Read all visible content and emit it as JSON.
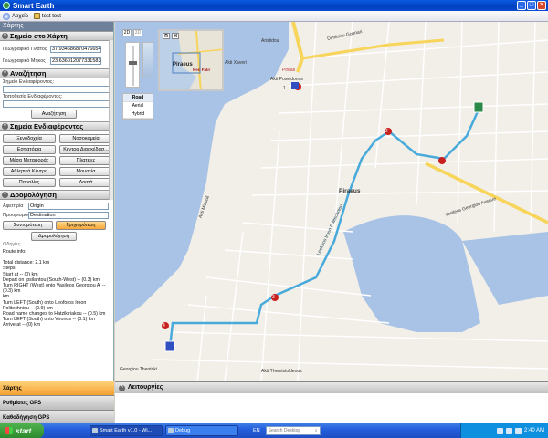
{
  "window": {
    "title": "Smart Earth"
  },
  "menubar": {
    "items": [
      {
        "label": "Αρχείο"
      },
      {
        "label": "test test"
      }
    ]
  },
  "left_panel": {
    "header": "Χάρτης",
    "map_point": {
      "title": "Σημείο στο Χάρτη",
      "lat_label": "Γεωγραφικό Πλάτος",
      "lat_value": "37.934686870476654",
      "lon_label": "Γεωγραφικό Μήκος",
      "lon_value": "23.636012077331583"
    },
    "search": {
      "title": "Αναζήτηση",
      "poi_label": "Σημείο Ενδιαφέροντος:",
      "location_label": "Τοποθεσία Ενδιαφέροντος:",
      "button": "Αναζήτηση"
    },
    "poi": {
      "title": "Σημεία Ενδιαφέροντος",
      "buttons": [
        "Ξενοδοχεία",
        "Νοσοκομεία",
        "Εστιατόρια",
        "Κέντρα Διασκέδασ...",
        "Μέσα Μεταφοράς",
        "Πλατείες",
        "Αθλητικά Κέντρα",
        "Μουσεία",
        "Παραλίες",
        "Λοιπά"
      ]
    },
    "routing": {
      "title": "Δρομολόγηση",
      "start_label": "Αφετηρία",
      "start_value": "Origin",
      "dest_label": "Προορισμός",
      "dest_value": "Destination",
      "shortest": "Συντομότερη",
      "fastest": "Γρηγορότερη",
      "route_button": "Δρομολόγηση",
      "directions_label": "Οδηγίες",
      "info": [
        "Route info:",
        "",
        "Total distance: 2.1 km",
        "Steps:",
        "Start at  -- (0) km",
        "Depart   on Ipsilantou (South-West) -- (0.3) km",
        "Turn RIGHT (West) onto Vasileos Georgiou A' -- (0.3) km",
        "km",
        "Turn LEFT (South) onto Leoforos Iroon Politechniou -- (0.9) km",
        "Road name changes to Hatzikiriakou -- (0.5) km",
        "Turn LEFT (South) onto Vironos -- (0.1) km",
        "Arrive at  -- (0) km"
      ]
    },
    "bottom_tabs": [
      "Χάρτης",
      "Ρυθμίσεις GPS",
      "Καθοδήγηση GPS"
    ]
  },
  "map": {
    "mode_2d": "2D",
    "mode_3d": "3D",
    "map_types": [
      "Road",
      "Aerial",
      "Hybrid"
    ],
    "overview_label": "Piraeus",
    "overview_sublabel": "Neo Falir",
    "overview_r": "R",
    "overview_h": "H",
    "labels": {
      "piraeus": "Piraeus",
      "piraeus_station": "Pireas",
      "vasileos": "Vasileos Georgiou Avenue",
      "akti_miaouli": "Akti Miaouli",
      "akti_xaveri": "Akti Xaveri",
      "akti_themistokleous": "Akti Themistokleous",
      "aristidou": "Aristidou",
      "dimitriou_gounari": "Dimitriou Gounari",
      "georgiou_theotoki": "Georgiou Theotoki",
      "akti_poseidonos": "Akti Poseidonos",
      "iroon": "Leoforos Iroon Politechniou"
    },
    "waypoints": [
      "1",
      "2",
      "3",
      "4"
    ]
  },
  "functions_panel": {
    "title": "Λειτουργίες"
  },
  "taskbar": {
    "start": "start",
    "items": [
      "Smart Earth v1.0 - Wi...",
      "Debug"
    ],
    "lang": "EN",
    "search_placeholder": "Search Desktop",
    "time": "2:40 AM"
  }
}
